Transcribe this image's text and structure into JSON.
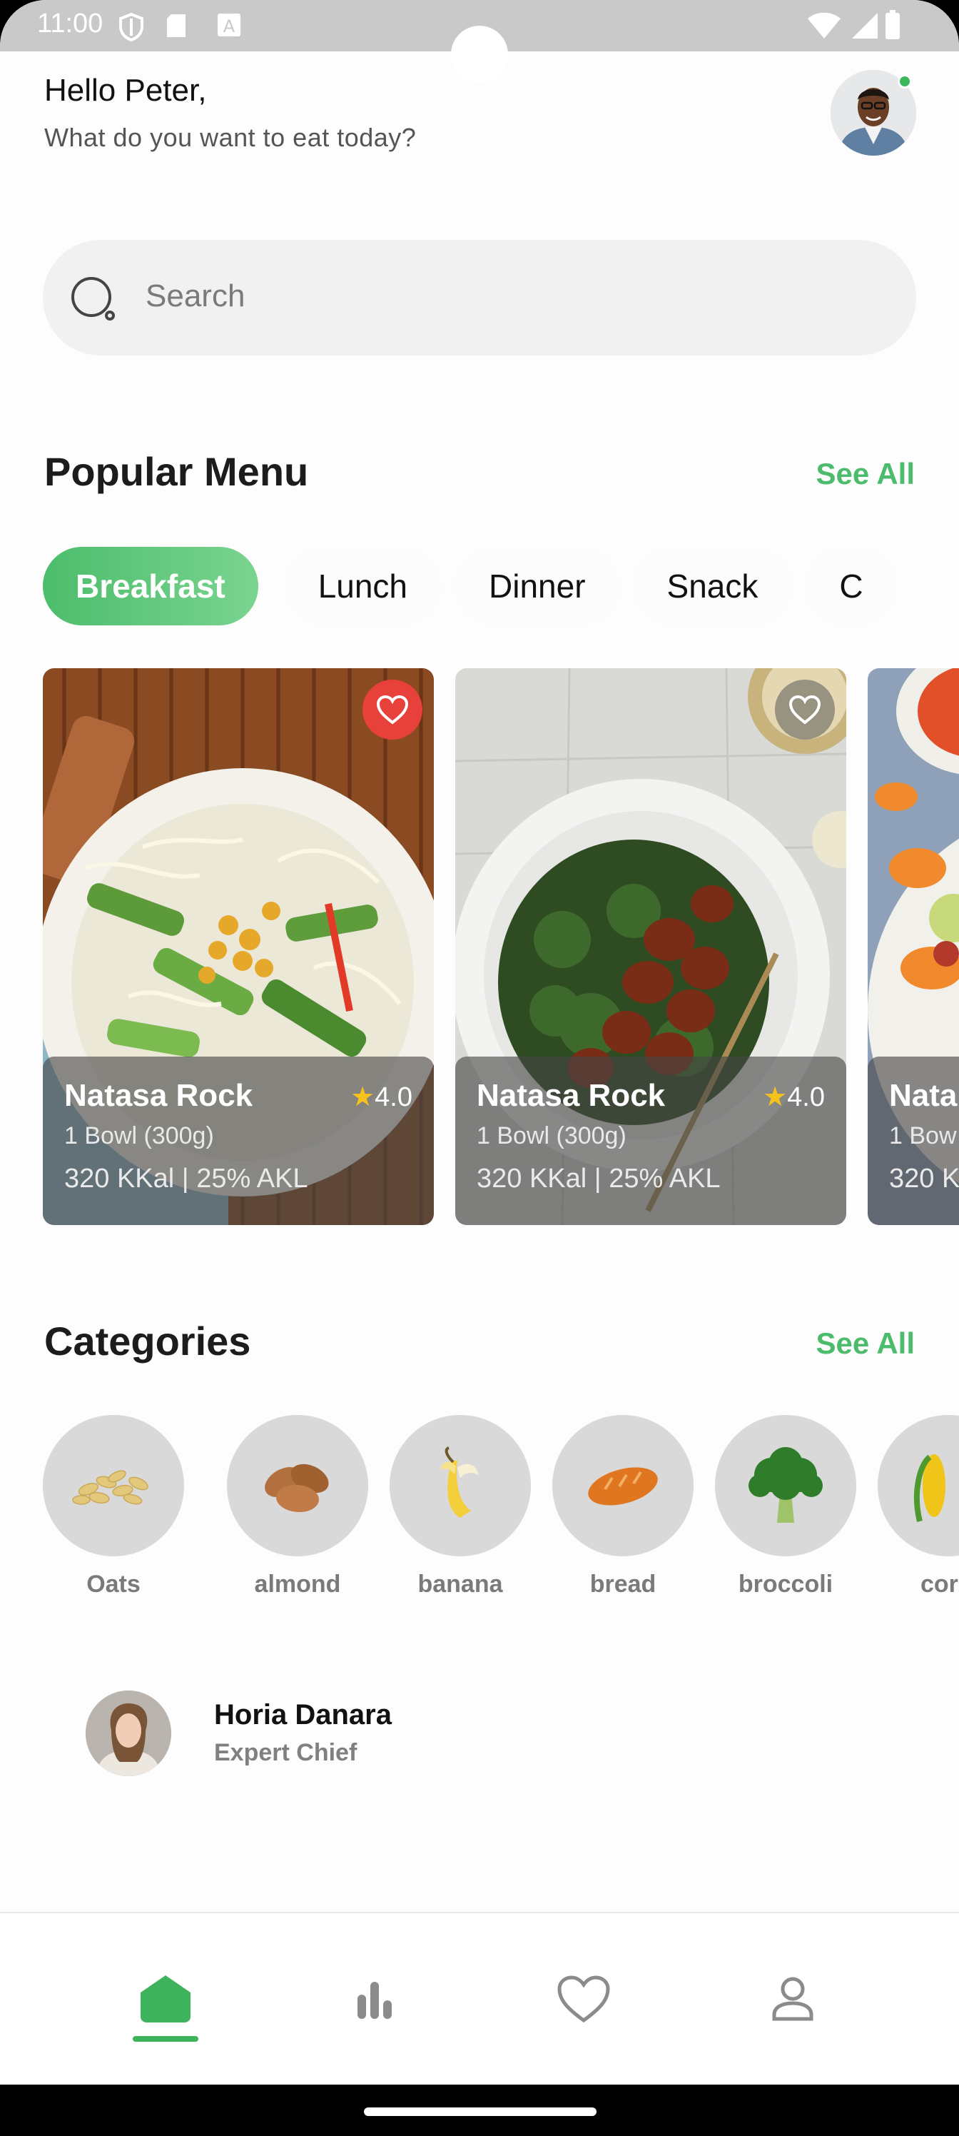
{
  "status_bar": {
    "time": "11:00"
  },
  "header": {
    "greeting": "Hello Peter,",
    "subtitle": "What do you want to eat today?"
  },
  "search": {
    "placeholder": "Search"
  },
  "popular": {
    "title": "Popular Menu",
    "see_all": "See All",
    "tabs": [
      "Breakfast",
      "Lunch",
      "Dinner",
      "Snack",
      "C"
    ],
    "active_tab": "Breakfast",
    "cards": [
      {
        "name": "Natasa Rock",
        "rating": "4.0",
        "portion": "1 Bowl (300g)",
        "kcal": "320 KKal | 25% AKL",
        "favorite": true
      },
      {
        "name": "Natasa Rock",
        "rating": "4.0",
        "portion": "1 Bowl (300g)",
        "kcal": "320 KKal | 25% AKL",
        "favorite": false
      },
      {
        "name": "Nata",
        "rating": "",
        "portion": "1 Bow",
        "kcal": "320 K",
        "favorite": false
      }
    ]
  },
  "categories": {
    "title": "Categories",
    "see_all": "See All",
    "items": [
      {
        "label": "Oats",
        "icon": "oats-icon"
      },
      {
        "label": "almond",
        "icon": "almond-icon"
      },
      {
        "label": "banana",
        "icon": "banana-icon"
      },
      {
        "label": "bread",
        "icon": "bread-icon"
      },
      {
        "label": "broccoli",
        "icon": "broccoli-icon"
      },
      {
        "label": "cor",
        "icon": "corn-icon"
      }
    ]
  },
  "chef": {
    "name": "Horia Danara",
    "role": "Expert Chief"
  },
  "bottom_nav": {
    "items": [
      "home-icon",
      "stats-icon",
      "heart-icon",
      "profile-icon"
    ],
    "active": "home-icon"
  },
  "colors": {
    "accent": "#4cbc6c",
    "favorite": "#e8403b",
    "star": "#f6c21c"
  }
}
